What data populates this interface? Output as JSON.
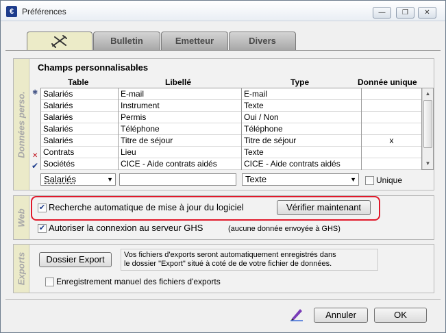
{
  "window": {
    "title": "Préférences",
    "controls": {
      "minimize": "—",
      "maximize": "❐",
      "close": "✕"
    }
  },
  "tabs": [
    {
      "label": ""
    },
    {
      "label": "Bulletin"
    },
    {
      "label": "Emetteur"
    },
    {
      "label": "Divers"
    }
  ],
  "donnees": {
    "section_label": "Données perso.",
    "heading": "Champs personnalisables",
    "columns": [
      "Table",
      "Libellé",
      "Type",
      "Donnée unique"
    ],
    "rows": [
      {
        "table": "Salariés",
        "libelle": "E-mail",
        "type": "E-mail",
        "unique": ""
      },
      {
        "table": "Salariés",
        "libelle": "Instrument",
        "type": "Texte",
        "unique": ""
      },
      {
        "table": "Salariés",
        "libelle": "Permis",
        "type": "Oui / Non",
        "unique": ""
      },
      {
        "table": "Salariés",
        "libelle": "Téléphone",
        "type": "Téléphone",
        "unique": ""
      },
      {
        "table": "Salariés",
        "libelle": "Titre de séjour",
        "type": "Titre de séjour",
        "unique": "x"
      },
      {
        "table": "Contrats",
        "libelle": "Lieu",
        "type": "Texte",
        "unique": ""
      },
      {
        "table": "Sociétés",
        "libelle": "CICE - Aide contrats aidés",
        "type": "CICE - Aide contrats aidés",
        "unique": ""
      }
    ],
    "editor": {
      "table_value": "Salariés",
      "libelle_value": "",
      "type_value": "Texte",
      "unique_label": "Unique"
    }
  },
  "web": {
    "section_label": "Web",
    "auto_update_label": "Recherche automatique de mise à jour du logiciel",
    "auto_update_checked": true,
    "verify_button": "Vérifier maintenant",
    "ghs_label": "Autoriser la connexion au serveur GHS",
    "ghs_checked": true,
    "ghs_note": "(aucune donnée envoyée à GHS)"
  },
  "exports": {
    "section_label": "Exports",
    "folder_button": "Dossier Export",
    "info_line1": "Vos fichiers d'exports seront automatiquement enregistrés dans",
    "info_line2": "le dossier \"Export\" situé à coté de de votre fichier de données.",
    "manual_label": "Enregistrement manuel des fichiers d'exports",
    "manual_checked": false
  },
  "footer": {
    "cancel": "Annuler",
    "ok": "OK"
  },
  "colors": {
    "highlight": "#e0192a",
    "section_label_bg": "#ebeac9",
    "active_tab_bg": "#ecebc8",
    "check_color": "#1d3c8c"
  }
}
